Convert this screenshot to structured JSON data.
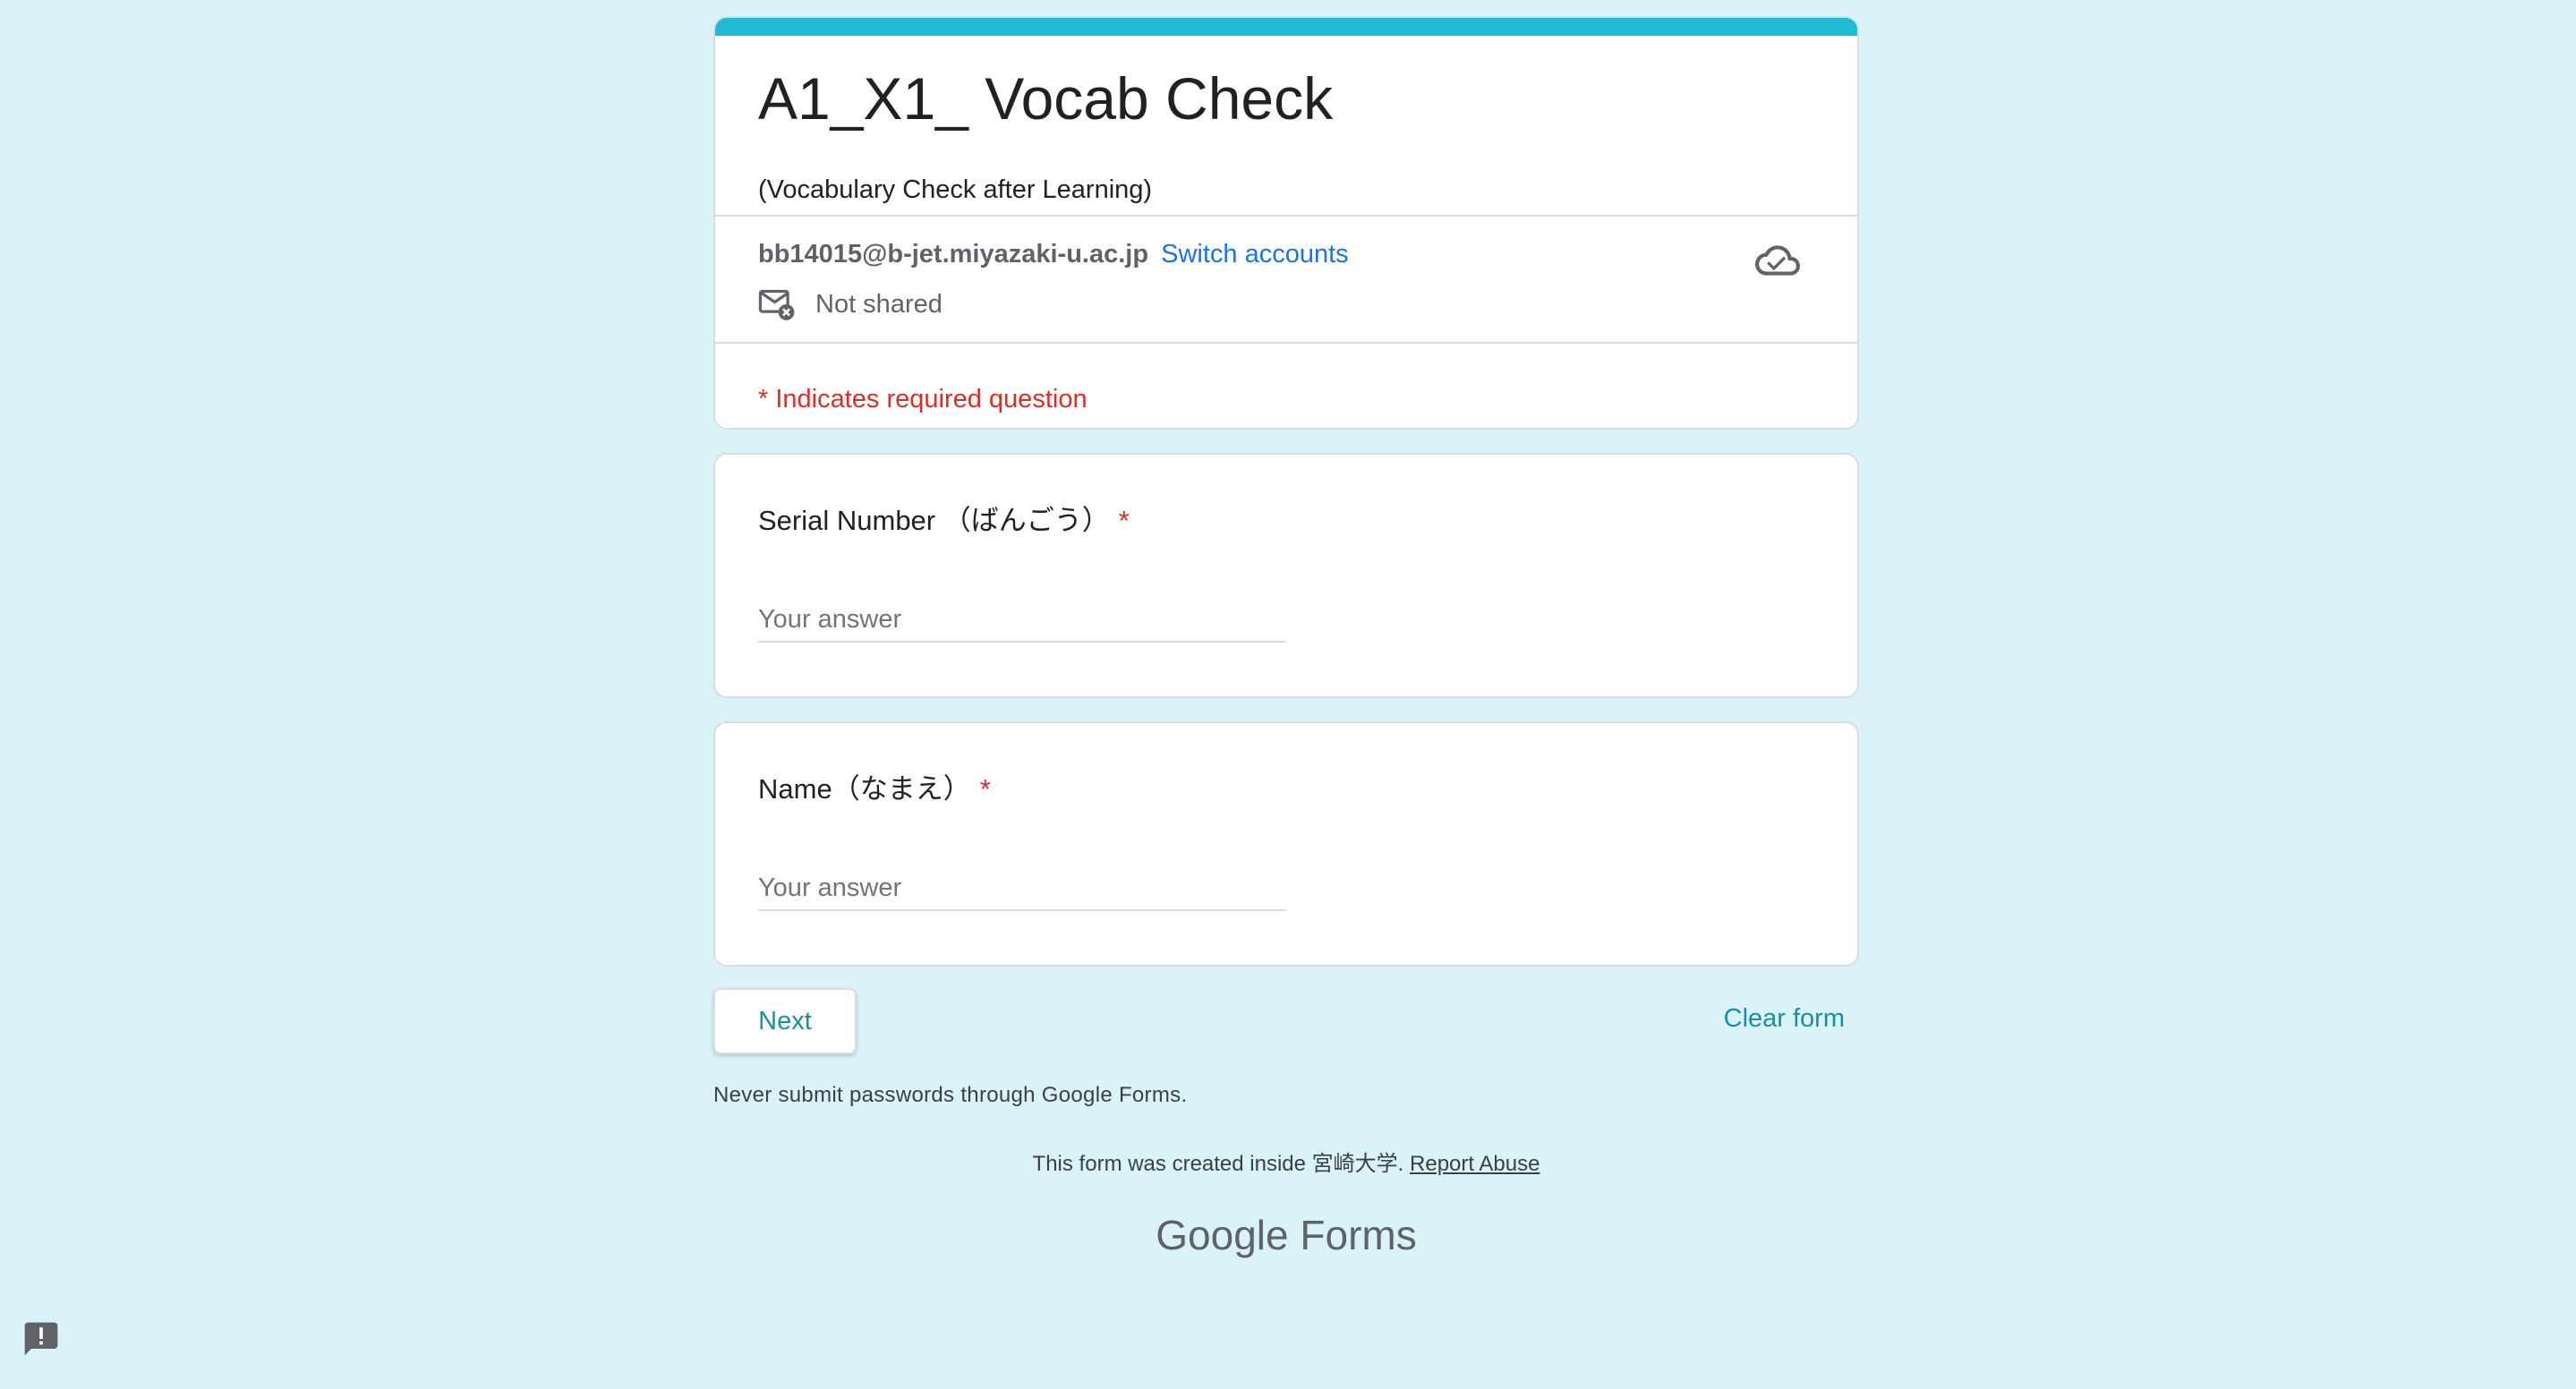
{
  "form": {
    "title": "A1_X1_ Vocab Check",
    "description": "(Vocabulary Check after Learning)",
    "account_email": "bb14015@b-jet.miyazaki-u.ac.jp",
    "switch_accounts": "Switch accounts",
    "not_shared": "Not shared",
    "required_note": "* Indicates required question"
  },
  "questions": [
    {
      "label": "Serial Number （ばんごう）",
      "required_mark": "*",
      "placeholder": "Your answer"
    },
    {
      "label": "Name（なまえ）",
      "required_mark": "*",
      "placeholder": "Your answer"
    }
  ],
  "actions": {
    "next": "Next",
    "clear": "Clear form"
  },
  "footer": {
    "warning": "Never submit passwords through Google Forms.",
    "created_prefix": "This form was created inside 宮崎大学.",
    "report_abuse": "Report Abuse",
    "logo_google": "Google",
    "logo_forms": "Forms"
  },
  "icons": {
    "cloud": "cloud-check-icon",
    "mail": "mail-not-shared-icon",
    "feedback": "feedback-icon"
  },
  "colors": {
    "background": "#daf3f8",
    "accent": "#1fbbd2",
    "link": "#1a73e8",
    "required": "#d93025",
    "button_text": "#1a8fa3"
  }
}
